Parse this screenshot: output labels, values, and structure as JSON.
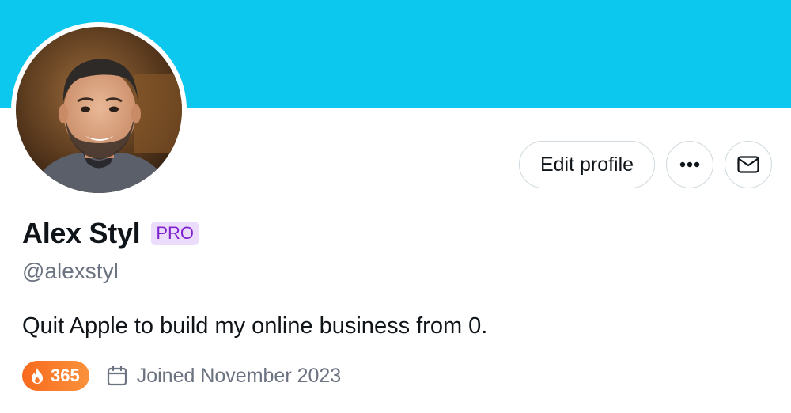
{
  "profile": {
    "banner_color": "#0cc8ef",
    "avatar_icon": "profile-photo",
    "name": "Alex Styl",
    "badge": "PRO",
    "handle": "@alexstyl",
    "bio": "Quit Apple to build my online business from 0.",
    "streak": "365",
    "joined": "Joined November 2023"
  },
  "actions": {
    "edit_label": "Edit profile",
    "more_icon": "more-horizontal-icon",
    "message_icon": "mail-icon"
  },
  "colors": {
    "badge_text": "#7e22ce",
    "badge_bg": "#ecdcfb",
    "streak_start": "#f86a1d",
    "streak_end": "#fb923c",
    "secondary_text": "#6b7280"
  }
}
